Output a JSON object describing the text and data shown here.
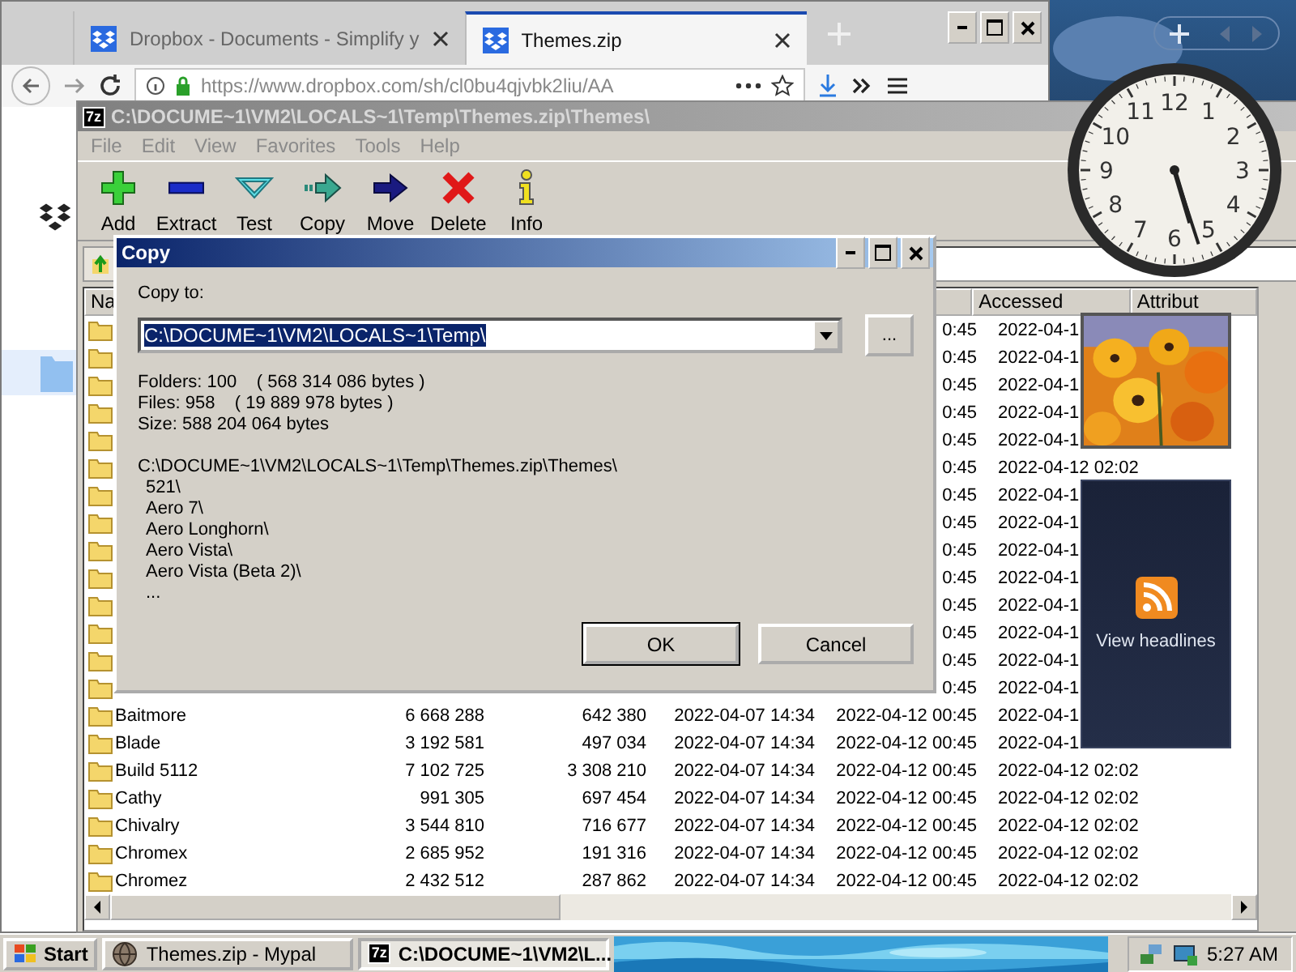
{
  "browser": {
    "tabs": [
      {
        "title": "Dropbox - Documents - Simplify y",
        "selected": false
      },
      {
        "title": "Themes.zip",
        "selected": true
      }
    ],
    "url": "https://www.dropbox.com/sh/cl0bu4qjvbk2liu/AA"
  },
  "archive_window": {
    "icon_label": "7z",
    "title": "C:\\DOCUME~1\\VM2\\LOCALS~1\\Temp\\Themes.zip\\Themes\\",
    "menu": [
      "File",
      "Edit",
      "View",
      "Favorites",
      "Tools",
      "Help"
    ],
    "toolbar": [
      {
        "label": "Add",
        "kind": "add"
      },
      {
        "label": "Extract",
        "kind": "extract"
      },
      {
        "label": "Test",
        "kind": "test"
      },
      {
        "label": "Copy",
        "kind": "copy"
      },
      {
        "label": "Move",
        "kind": "move"
      },
      {
        "label": "Delete",
        "kind": "delete"
      },
      {
        "label": "Info",
        "kind": "info"
      }
    ],
    "columns": [
      {
        "label": "Na",
        "kind": "name"
      },
      {
        "label": "Accessed",
        "kind": "accessed"
      },
      {
        "label": "Attribut",
        "kind": "attributes"
      }
    ],
    "rows": [
      {
        "created": "0:45",
        "accessed": "2022-04-1"
      },
      {
        "created": "0:45",
        "accessed": "2022-04-1"
      },
      {
        "created": "0:45",
        "accessed": "2022-04-1"
      },
      {
        "created": "0:45",
        "accessed": "2022-04-1"
      },
      {
        "created": "0:45",
        "accessed": "2022-04-1"
      },
      {
        "created": "0:45",
        "accessed": "2022-04-12 02:02"
      },
      {
        "created": "0:45",
        "accessed": "2022-04-1"
      },
      {
        "created": "0:45",
        "accessed": "2022-04-1"
      },
      {
        "created": "0:45",
        "accessed": "2022-04-1"
      },
      {
        "created": "0:45",
        "accessed": "2022-04-1"
      },
      {
        "created": "0:45",
        "accessed": "2022-04-1"
      },
      {
        "created": "0:45",
        "accessed": "2022-04-1"
      },
      {
        "created": "0:45",
        "accessed": "2022-04-1"
      },
      {
        "created": "0:45",
        "accessed": "2022-04-1"
      },
      {
        "name": "Baitmore",
        "size": "6 668 288",
        "packed_size": "642 380",
        "modified": "2022-04-07 14:34",
        "created": "2022-04-12 00:45",
        "accessed": "2022-04-1"
      },
      {
        "name": "Blade",
        "size": "3 192 581",
        "packed_size": "497 034",
        "modified": "2022-04-07 14:34",
        "created": "2022-04-12 00:45",
        "accessed": "2022-04-1"
      },
      {
        "name": "Build 5112",
        "size": "7 102 725",
        "packed_size": "3 308 210",
        "modified": "2022-04-07 14:34",
        "created": "2022-04-12 00:45",
        "accessed": "2022-04-12 02:02"
      },
      {
        "name": "Cathy",
        "size": "991 305",
        "packed_size": "697 454",
        "modified": "2022-04-07 14:34",
        "created": "2022-04-12 00:45",
        "accessed": "2022-04-12 02:02"
      },
      {
        "name": "Chivalry",
        "size": "3 544 810",
        "packed_size": "716 677",
        "modified": "2022-04-07 14:34",
        "created": "2022-04-12 00:45",
        "accessed": "2022-04-12 02:02"
      },
      {
        "name": "Chromex",
        "size": "2 685 952",
        "packed_size": "191 316",
        "modified": "2022-04-07 14:34",
        "created": "2022-04-12 00:45",
        "accessed": "2022-04-12 02:02"
      },
      {
        "name": "Chromez",
        "size": "2 432 512",
        "packed_size": "287 862",
        "modified": "2022-04-07 14:34",
        "created": "2022-04-12 00:45",
        "accessed": "2022-04-12 02:02"
      }
    ]
  },
  "copy_dialog": {
    "title": "Copy",
    "label": "Copy to:",
    "value": "C:\\DOCUME~1\\VM2\\LOCALS~1\\Temp\\",
    "browse": "...",
    "info": [
      "Folders: 100    ( 568 314 086 bytes )",
      "Files: 958    ( 19 889 978 bytes )",
      "Size: 588 204 064 bytes"
    ],
    "listing_path": "C:\\DOCUME~1\\VM2\\LOCALS~1\\Temp\\Themes.zip\\Themes\\",
    "listing": [
      "521\\",
      "Aero 7\\",
      "Aero Longhorn\\",
      "Aero Vista\\",
      "Aero Vista (Beta 2)\\",
      "..."
    ],
    "buttons": [
      "OK",
      "Cancel"
    ]
  },
  "clock": {
    "numerals": [
      "12",
      "11",
      "1",
      "10",
      "2",
      "9",
      "3",
      "8",
      "4",
      "7",
      "5",
      "6"
    ]
  },
  "headlines": {
    "label": "View headlines"
  },
  "taskbar": {
    "start": "Start",
    "tasks": [
      {
        "label": "Themes.zip - Mypal",
        "kind": "browser",
        "selected": false
      },
      {
        "label": "C:\\DOCUME~1\\VM2\\L...",
        "kind": "archive",
        "icon_label": "7z",
        "selected": true
      }
    ],
    "time": "5:27 AM"
  }
}
